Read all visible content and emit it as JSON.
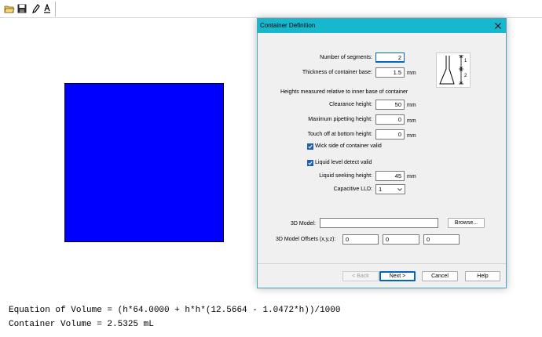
{
  "output": {
    "equation": "Equation of Volume = (h*64.0000 + h*h*(12.5664 - 1.0472*h))/1000",
    "volume": "Container Volume = 2.5325 mL"
  },
  "dialog": {
    "title": "Container Definition",
    "diagram": {
      "labels": [
        "1",
        "2"
      ]
    },
    "segments": {
      "label": "Number of segments:",
      "value": "2"
    },
    "thickness": {
      "label": "Thickness of container base:",
      "value": "1.5",
      "unit": "mm"
    },
    "heights_note": "Heights measured relative to inner base of container",
    "clearance": {
      "label": "Clearance height:",
      "value": "50",
      "unit": "mm"
    },
    "max_pipetting": {
      "label": "Maximum pipetting height:",
      "value": "0",
      "unit": "mm"
    },
    "touch_off": {
      "label": "Touch off at bottom height:",
      "value": "0",
      "unit": "mm"
    },
    "wick_side": {
      "label": "Wick side of container valid",
      "checked": true
    },
    "lld_valid": {
      "label": "Liquid level detect valid",
      "checked": true
    },
    "liquid_seeking": {
      "label": "Liquid seeking height:",
      "value": "45",
      "unit": "mm"
    },
    "capacitive_lld": {
      "label": "Capacitive LLD:",
      "value": "1"
    },
    "model_3d": {
      "label": "3D Model:",
      "value": "",
      "browse_label": "Browse..."
    },
    "offsets": {
      "label": "3D Model Offsets (x,y,z):",
      "x": "0",
      "y": "0",
      "z": "0"
    },
    "buttons": {
      "back": "< Back",
      "next": "Next >",
      "cancel": "Cancel",
      "help": "Help"
    }
  },
  "colors": {
    "titlebar": "#17b7cd",
    "shape": "#0000ff",
    "checkbox": "#1e5fb0"
  },
  "toolbar_icons": [
    "open-folder-icon",
    "save-icon",
    "pencil-icon",
    "font-icon"
  ]
}
